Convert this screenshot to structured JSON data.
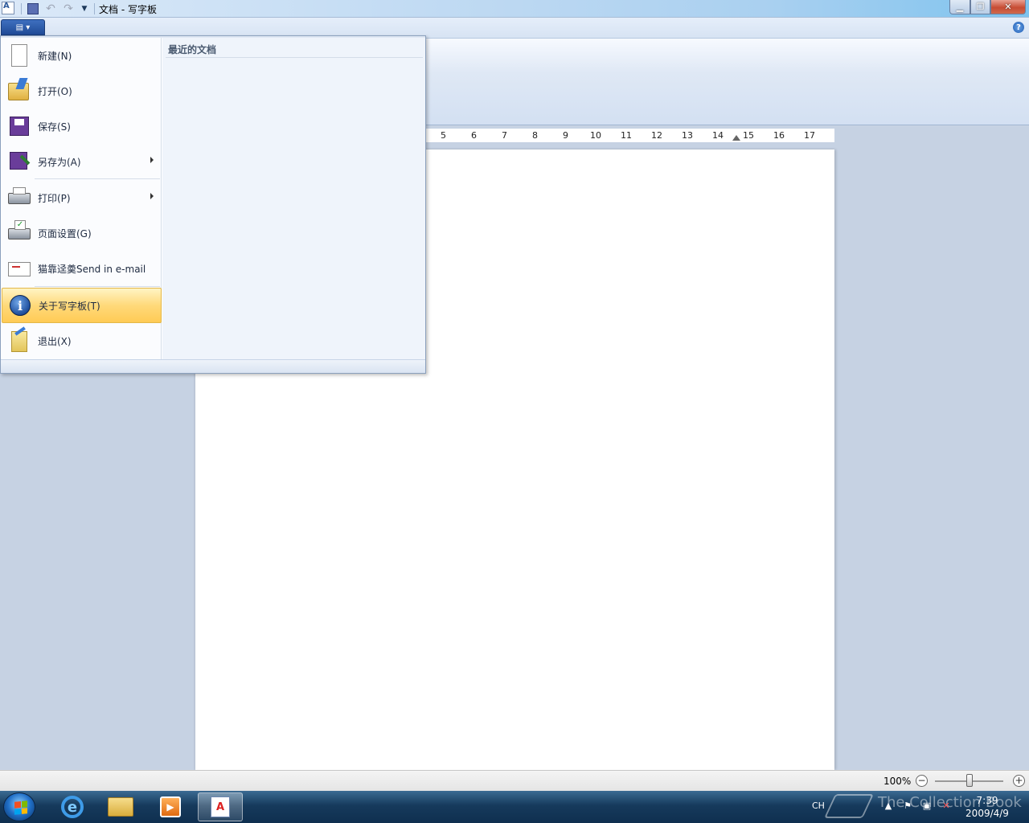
{
  "window": {
    "title": "文档 - 写字板",
    "controls": {
      "minimize": "▁",
      "maximize": "❐",
      "close": "✕"
    }
  },
  "quick_access": {
    "undo": "↶",
    "redo": "↷",
    "more": "▼"
  },
  "ribbon": {
    "app_button": "▤ ▾",
    "help": "?"
  },
  "ruler": {
    "ticks": [
      "5",
      "6",
      "7",
      "8",
      "9",
      "10",
      "11",
      "12",
      "13",
      "14",
      "15",
      "16",
      "17"
    ]
  },
  "app_menu": {
    "items": [
      {
        "label": "新建(N)",
        "icon": "new-document-icon"
      },
      {
        "label": "打开(O)",
        "icon": "open-folder-icon"
      },
      {
        "label": "保存(S)",
        "icon": "save-disk-icon"
      },
      {
        "label": "另存为(A)",
        "icon": "save-as-icon",
        "submenu": true
      },
      {
        "label": "打印(P)",
        "icon": "printer-icon",
        "submenu": true
      },
      {
        "label": "页面设置(G)",
        "icon": "page-setup-icon"
      },
      {
        "label": "猫靠迳羮Send in e-mail",
        "icon": "email-icon"
      },
      {
        "label": "关于写字板(T)",
        "icon": "info-icon",
        "highlighted": true
      },
      {
        "label": "退出(X)",
        "icon": "exit-icon"
      }
    ],
    "recent_documents_title": "最近的文档"
  },
  "statusbar": {
    "zoom_level": "100%",
    "zoom_out": "−",
    "zoom_in": "+",
    "zoom_slider_fraction": 0.5
  },
  "taskbar": {
    "ie_glyph": "e",
    "media_glyph": "▶",
    "wordpad_glyph": "A",
    "language": "CH",
    "time": "7:39",
    "date": "2009/4/9",
    "watermark": "The Collection Book"
  }
}
